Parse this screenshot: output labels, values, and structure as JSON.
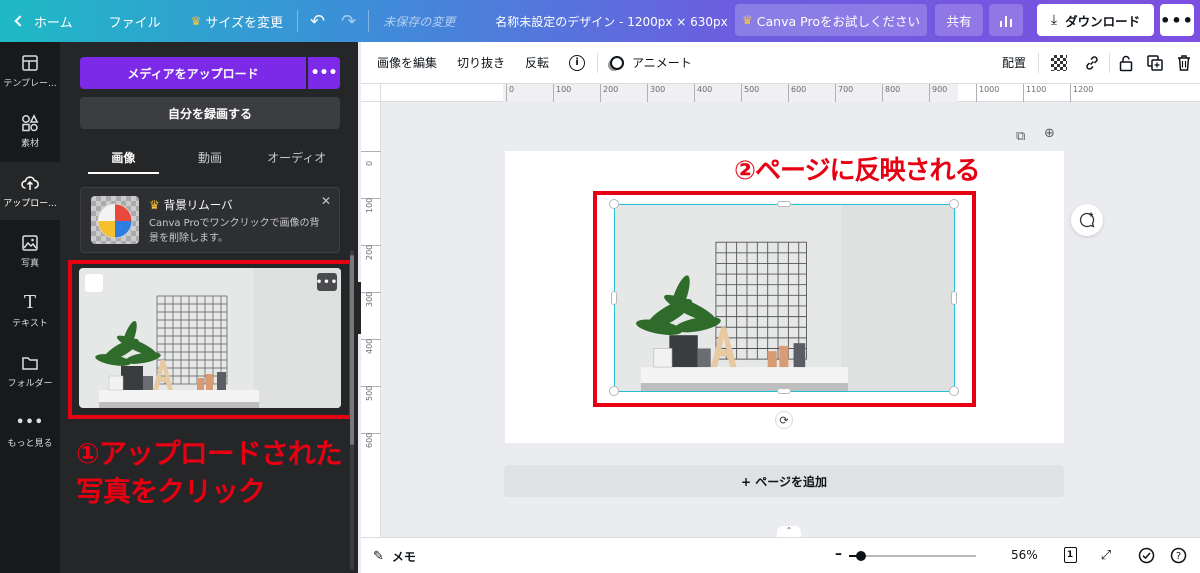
{
  "topbar": {
    "home": "ホーム",
    "file": "ファイル",
    "resize": "サイズを変更",
    "unsaved": "未保存の変更",
    "doc_title": "名称未設定のデザイン - 1200px × 630px",
    "pro_trial": "Canva Proをお試しください",
    "share": "共有",
    "download": "ダウンロード",
    "more": "•••"
  },
  "rail": {
    "items": [
      {
        "label": "テンプレー...",
        "icon": "template-icon"
      },
      {
        "label": "素材",
        "icon": "elements-icon"
      },
      {
        "label": "アップロー...",
        "icon": "upload-cloud-icon"
      },
      {
        "label": "写真",
        "icon": "photo-icon"
      },
      {
        "label": "テキスト",
        "icon": "text-icon"
      },
      {
        "label": "フォルダー",
        "icon": "folder-icon"
      },
      {
        "label": "もっと見る",
        "icon": "more-dots-icon"
      }
    ]
  },
  "panel": {
    "upload_button": "メディアをアップロード",
    "upload_more": "•••",
    "record_button": "自分を録画する",
    "tabs": [
      "画像",
      "動画",
      "オーディオ"
    ],
    "promo_title": "背景リムーバ",
    "promo_desc": "Canva Proでワンクリックで画像の背景を削除します。",
    "upload_item_more": "•••"
  },
  "annotations": {
    "left_line1": "①アップロードされた",
    "left_line2": "写真をクリック",
    "right": "②ページに反映される",
    "color": "#e60012"
  },
  "toolbar": {
    "edit_image": "画像を編集",
    "crop": "切り抜き",
    "flip": "反転",
    "info": "i",
    "animate": "アニメート",
    "position": "配置"
  },
  "ruler": {
    "h_ticks": [
      "0",
      "100",
      "200",
      "300",
      "400",
      "500",
      "600",
      "700",
      "800",
      "900",
      "1000",
      "1100",
      "1200"
    ],
    "v_ticks": [
      "0",
      "100",
      "200",
      "300",
      "400",
      "500",
      "600"
    ]
  },
  "canvas": {
    "add_page": "+ ページを追加"
  },
  "bottombar": {
    "memo": "メモ",
    "zoom": "56%",
    "zoom_fraction": 0.56,
    "page_count": "1"
  },
  "colors": {
    "accent_purple": "#7d2ae8",
    "selection_cyan": "#21c2d4",
    "annotation_red": "#e60012"
  }
}
